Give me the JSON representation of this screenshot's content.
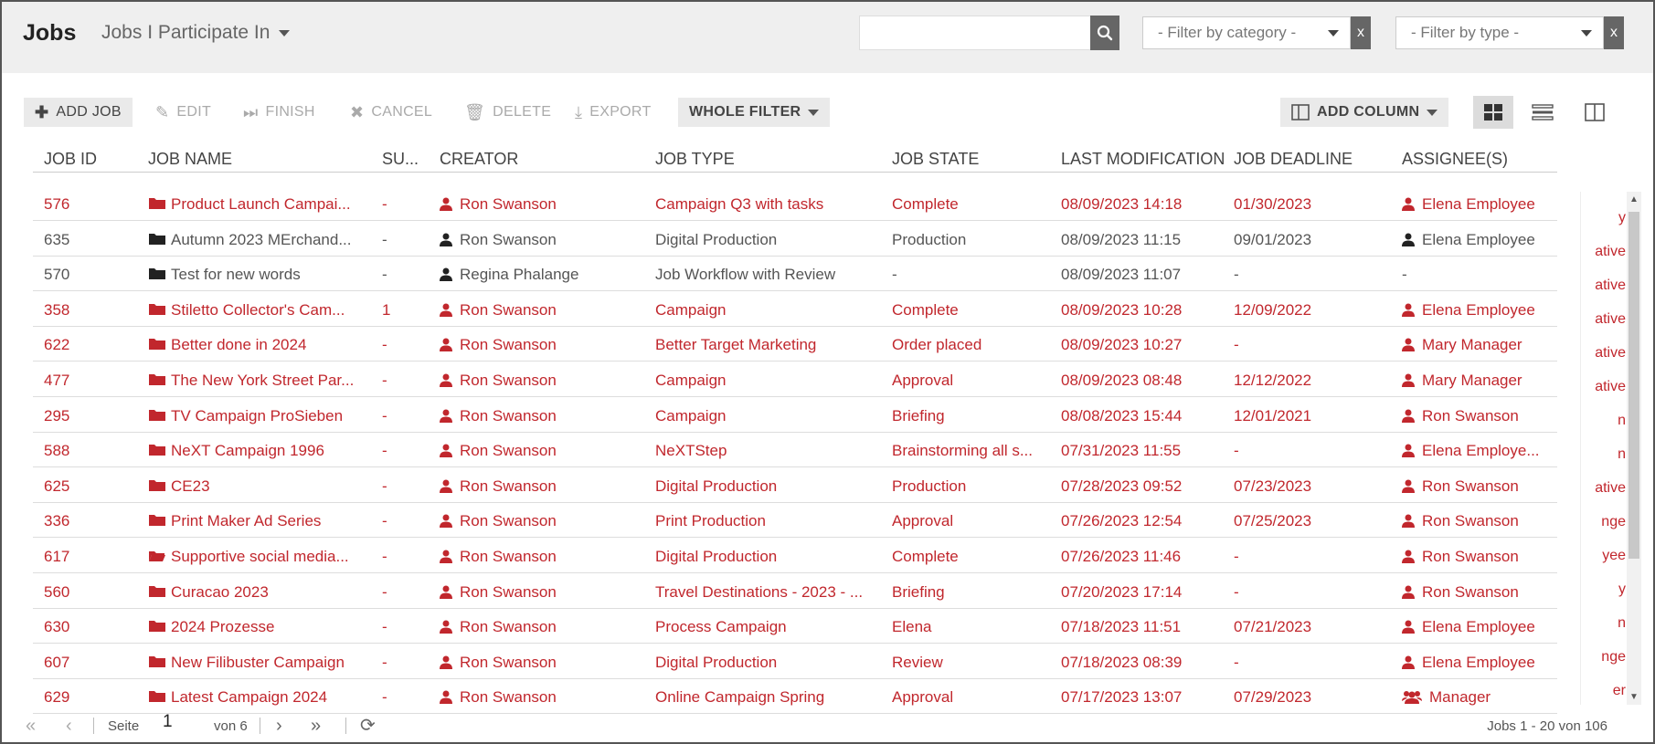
{
  "header": {
    "title": "Jobs",
    "view_label": "Jobs I Participate In",
    "filter_category_placeholder": "- Filter by category -",
    "filter_type_placeholder": "- Filter by type -",
    "clear_label": "x"
  },
  "toolbar": {
    "add_job": "ADD JOB",
    "edit": "EDIT",
    "finish": "FINISH",
    "cancel": "CANCEL",
    "delete": "DELETE",
    "export": "EXPORT",
    "whole_filter": "WHOLE FILTER",
    "add_column": "ADD COLUMN"
  },
  "columns": [
    "JOB ID",
    "JOB NAME",
    "SU...",
    "CREATOR",
    "JOB TYPE",
    "JOB STATE",
    "LAST MODIFICATION",
    "JOB DEADLINE",
    "ASSIGNEE(S)"
  ],
  "rows": [
    {
      "id": "576",
      "name": "Product Launch Campai...",
      "su": "-",
      "creator": "Ron Swanson",
      "type": "Campaign Q3 with tasks",
      "state": "Complete",
      "modified": "08/09/2023 14:18",
      "deadline": "01/30/2023",
      "assignee": "Elena Employee",
      "highlight": true
    },
    {
      "id": "635",
      "name": "Autumn 2023 MErchand...",
      "su": "-",
      "creator": "Ron Swanson",
      "type": "Digital Production",
      "state": "Production",
      "modified": "08/09/2023 11:15",
      "deadline": "09/01/2023",
      "assignee": "Elena Employee",
      "highlight": false
    },
    {
      "id": "570",
      "name": "Test for new words",
      "su": "-",
      "creator": "Regina Phalange",
      "type": "Job Workflow with Review",
      "state": "-",
      "modified": "08/09/2023 11:07",
      "deadline": "-",
      "assignee": "-",
      "highlight": false
    },
    {
      "id": "358",
      "name": "Stiletto Collector's Cam...",
      "su": "1",
      "creator": "Ron Swanson",
      "type": "Campaign",
      "state": "Complete",
      "modified": "08/09/2023 10:28",
      "deadline": "12/09/2022",
      "assignee": "Elena Employee",
      "highlight": true
    },
    {
      "id": "622",
      "name": "Better done in 2024",
      "su": "-",
      "creator": "Ron Swanson",
      "type": "Better Target Marketing",
      "state": "Order placed",
      "modified": "08/09/2023 10:27",
      "deadline": "-",
      "assignee": "Mary Manager",
      "highlight": true
    },
    {
      "id": "477",
      "name": "The New York Street Par...",
      "su": "-",
      "creator": "Ron Swanson",
      "type": "Campaign",
      "state": "Approval",
      "modified": "08/09/2023 08:48",
      "deadline": "12/12/2022",
      "assignee": "Mary Manager",
      "highlight": true
    },
    {
      "id": "295",
      "name": "TV Campaign ProSieben",
      "su": "-",
      "creator": "Ron Swanson",
      "type": "Campaign",
      "state": "Briefing",
      "modified": "08/08/2023 15:44",
      "deadline": "12/01/2021",
      "assignee": "Ron Swanson",
      "highlight": true
    },
    {
      "id": "588",
      "name": "NeXT Campaign 1996",
      "su": "-",
      "creator": "Ron Swanson",
      "type": "NeXTStep",
      "state": "Brainstorming all s...",
      "modified": "07/31/2023 11:55",
      "deadline": "-",
      "assignee": "Elena Employe...",
      "highlight": true
    },
    {
      "id": "625",
      "name": "CE23",
      "su": "-",
      "creator": "Ron Swanson",
      "type": "Digital Production",
      "state": "Production",
      "modified": "07/28/2023 09:52",
      "deadline": "07/23/2023",
      "assignee": "Ron Swanson",
      "highlight": true
    },
    {
      "id": "336",
      "name": "Print Maker Ad Series",
      "su": "-",
      "creator": "Ron Swanson",
      "type": "Print Production",
      "state": "Approval",
      "modified": "07/26/2023 12:54",
      "deadline": "07/25/2023",
      "assignee": "Ron Swanson",
      "highlight": true
    },
    {
      "id": "617",
      "name": "Supportive social media...",
      "su": "-",
      "creator": "Ron Swanson",
      "type": "Digital Production",
      "state": "Complete",
      "modified": "07/26/2023 11:46",
      "deadline": "-",
      "assignee": "Ron Swanson",
      "highlight": true
    },
    {
      "id": "560",
      "name": "Curacao 2023",
      "su": "-",
      "creator": "Ron Swanson",
      "type": "Travel Destinations - 2023 - ...",
      "state": "Briefing",
      "modified": "07/20/2023 17:14",
      "deadline": "-",
      "assignee": "Ron Swanson",
      "highlight": true
    },
    {
      "id": "630",
      "name": "2024 Prozesse",
      "su": "-",
      "creator": "Ron Swanson",
      "type": "Process Campaign",
      "state": "Elena",
      "modified": "07/18/2023 11:51",
      "deadline": "07/21/2023",
      "assignee": "Elena Employee",
      "highlight": true
    },
    {
      "id": "607",
      "name": "New Filibuster Campaign",
      "su": "-",
      "creator": "Ron Swanson",
      "type": "Digital Production",
      "state": "Review",
      "modified": "07/18/2023 08:39",
      "deadline": "-",
      "assignee": "Elena Employee",
      "highlight": true
    },
    {
      "id": "629",
      "name": "Latest Campaign 2024",
      "su": "-",
      "creator": "Ron Swanson",
      "type": "Online Campaign Spring",
      "state": "Approval",
      "modified": "07/17/2023 13:07",
      "deadline": "07/29/2023",
      "assignee": "Manager",
      "highlight": true,
      "group": true
    }
  ],
  "side_panel_items": [
    "y",
    "ative",
    "ative",
    "ative",
    "ative",
    "ative",
    "n",
    "n",
    "ative",
    "nge",
    "yee",
    "y",
    "n",
    "nge",
    "er"
  ],
  "footer": {
    "page_label": "Seite",
    "page_value": "1",
    "of_label": "von 6",
    "summary": "Jobs 1 - 20 von 106"
  },
  "colors": {
    "accent": "#c1272d",
    "grey_text": "#555555",
    "header_bg": "#efefef"
  }
}
